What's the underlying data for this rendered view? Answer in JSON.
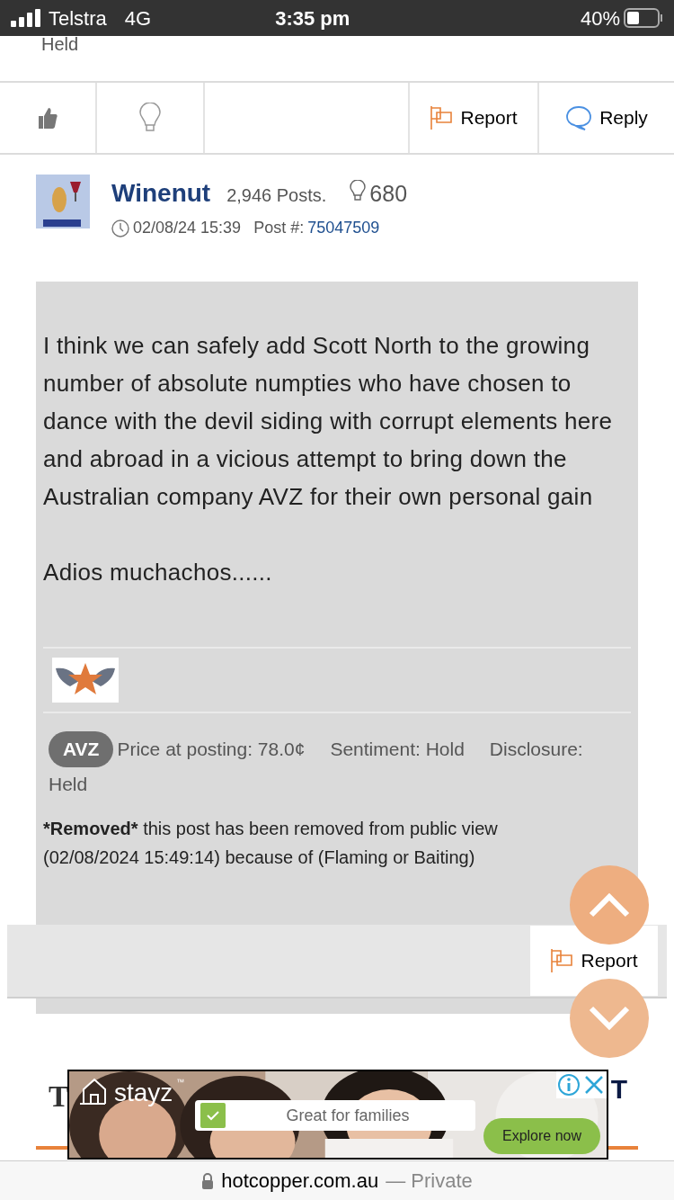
{
  "status_bar": {
    "carrier": "Telstra",
    "network": "4G",
    "time": "3:35 pm",
    "battery": "40%"
  },
  "previous_post": {
    "disclosure_tail": "Held"
  },
  "action_bar": {
    "items": [
      {
        "kind": "like"
      },
      {
        "kind": "idea"
      },
      {
        "kind": "report",
        "label": "Report"
      },
      {
        "kind": "reply",
        "label": "Reply"
      }
    ]
  },
  "post": {
    "author": "Winenut",
    "posts": "2,946 Posts.",
    "likes": "680",
    "date": "02/08/24 15:39",
    "post_number_label": "Post #:",
    "post_number": "75047509",
    "body": [
      "I think we can safely add Scott North to the growing number of absolute numpties who have chosen to dance with the devil siding with corrupt elements here and abroad in a vicious attempt to bring down the Australian company AVZ for their own personal gain",
      "Adios muchachos......"
    ],
    "stock_code": "AVZ",
    "price": "Price at posting: 78.0¢",
    "sentiment": "Sentiment: Hold",
    "disclosure_label": "Disclosure:",
    "disclosure_value": "Held",
    "removed_label": "*Removed*",
    "removed_text": "this post has been removed from public view (02/08/2024 15:49:14) because of (Flaming or Baiting)",
    "report": "Report"
  },
  "heading_fragments": [
    "T",
    "T"
  ],
  "ad": {
    "brand": "stayz",
    "trademark": "™",
    "tagline": "Great for families",
    "cta": "Explore now"
  },
  "url_bar": {
    "domain": "hotcopper.com.au",
    "mode": "— Private"
  }
}
